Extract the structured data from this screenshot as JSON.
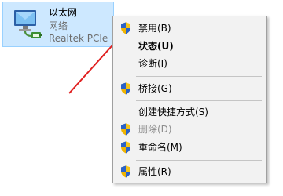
{
  "adapter": {
    "name": "以太网",
    "status": "网络",
    "device": "Realtek PCIe"
  },
  "context_menu": {
    "items": [
      {
        "label": "禁用(B)",
        "icon": "uac-shield-icon",
        "bold": false,
        "disabled": false
      },
      {
        "label": "状态(U)",
        "icon": null,
        "bold": true,
        "disabled": false
      },
      {
        "label": "诊断(I)",
        "icon": null,
        "bold": false,
        "disabled": false
      },
      {
        "label": "桥接(G)",
        "icon": "uac-shield-icon",
        "bold": false,
        "disabled": false
      },
      {
        "label": "创建快捷方式(S)",
        "icon": null,
        "bold": false,
        "disabled": false
      },
      {
        "label": "删除(D)",
        "icon": "uac-shield-icon",
        "bold": false,
        "disabled": true
      },
      {
        "label": "重命名(M)",
        "icon": "uac-shield-icon",
        "bold": false,
        "disabled": false
      },
      {
        "label": "属性(R)",
        "icon": "uac-shield-icon",
        "bold": false,
        "disabled": false
      }
    ]
  },
  "colors": {
    "selection_bg": "#cde8ff",
    "arrow": "#e02020",
    "menu_bg": "#f2f2f2"
  }
}
